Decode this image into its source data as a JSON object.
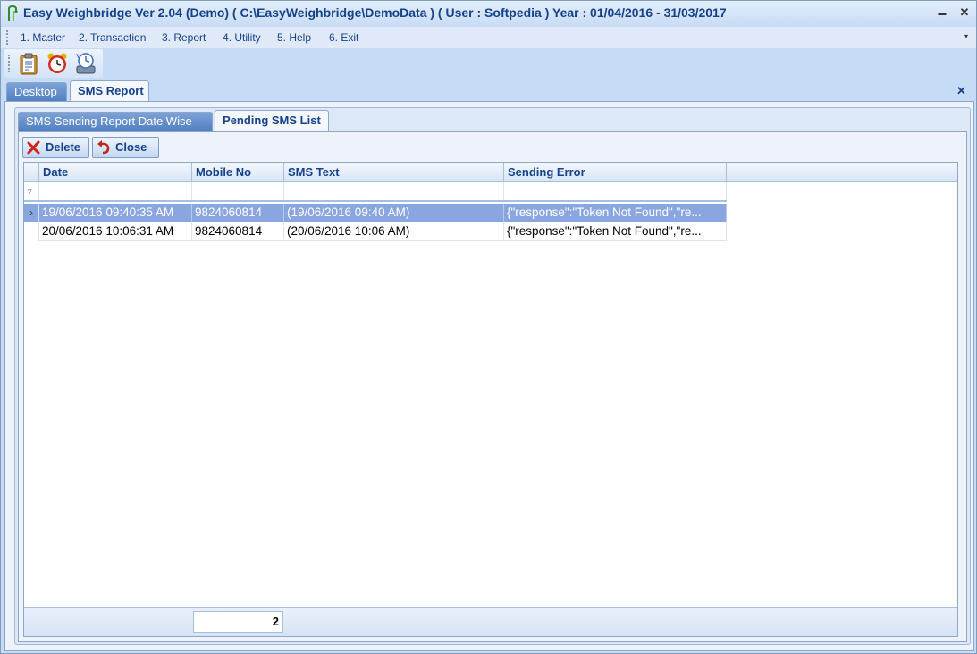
{
  "titlebar": {
    "title": "Easy Weighbridge Ver 2.04 (Demo)    ( C:\\EasyWeighbridge\\DemoData ) ( User : Softpedia ) Year : 01/04/2016 - 31/03/2017",
    "minimize": "–",
    "maximize": "▬",
    "close": "✕"
  },
  "menu": {
    "items": [
      "1. Master",
      "2. Transaction",
      "3. Report",
      "4. Utility",
      "5. Help",
      "6. Exit"
    ],
    "overflow_arrow": "▾"
  },
  "toolbar": {
    "icons": [
      "clipboard-icon",
      "alarm-clock-icon",
      "backup-icon"
    ]
  },
  "outer_tabs": {
    "tabs": [
      "Desktop",
      "SMS Report"
    ],
    "active": "SMS Report",
    "close": "✕"
  },
  "inner_tabs": {
    "tabs": [
      "SMS Sending Report Date Wise",
      "Pending SMS List"
    ],
    "active": "Pending SMS List"
  },
  "actions": {
    "delete_label": "Delete",
    "close_label": "Close"
  },
  "grid": {
    "columns": [
      "Date",
      "Mobile No",
      "SMS Text",
      "Sending Error"
    ],
    "rows": [
      {
        "date": "19/06/2016 09:40:35 AM",
        "mobile": "9824060814",
        "sms_text": "(19/06/2016 09:40 AM)",
        "error": "{\"response\":\"Token Not Found\",\"re...",
        "selected": true
      },
      {
        "date": "20/06/2016 10:06:31 AM",
        "mobile": "9824060814",
        "sms_text": "(20/06/2016 10:06 AM)",
        "error": "{\"response\":\"Token Not Found\",\"re...",
        "selected": false
      }
    ],
    "row_indicator": "›",
    "footer_count": "2"
  },
  "colors": {
    "title_text": "#15428b",
    "selected_row": "#8aa6e0",
    "tab_inactive": "#4f7fc2"
  }
}
